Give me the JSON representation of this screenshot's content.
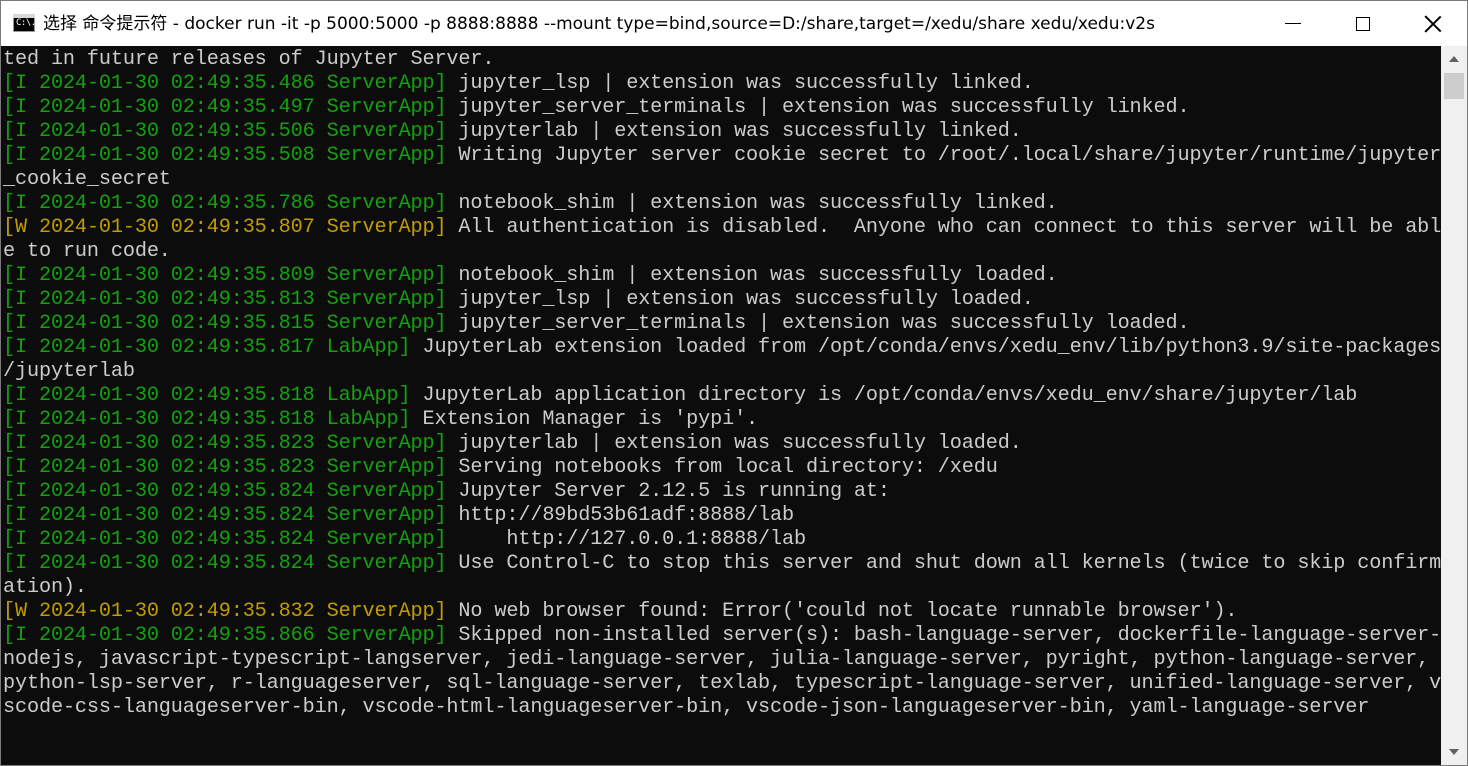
{
  "window": {
    "title": "选择 命令提示符 - docker  run -it -p 5000:5000 -p 8888:8888 --mount type=bind,source=D:/share,target=/xedu/share xedu/xedu:v2s",
    "icon_label": "C:\\."
  },
  "controls": {
    "minimize_icon": "minimize-icon",
    "maximize_icon": "maximize-icon",
    "close_icon": "close-icon"
  },
  "colors": {
    "background": "#0c0c0c",
    "text": "#cccccc",
    "info_prefix": "#13a10e",
    "warning_prefix": "#c19c00"
  },
  "console": {
    "lines": [
      {
        "prefix": "",
        "level": "",
        "text": "ted in future releases of Jupyter Server."
      },
      {
        "prefix": "[I 2024-01-30 02:49:35.486 ServerApp]",
        "level": "I",
        "text": " jupyter_lsp | extension was successfully linked."
      },
      {
        "prefix": "[I 2024-01-30 02:49:35.497 ServerApp]",
        "level": "I",
        "text": " jupyter_server_terminals | extension was successfully linked."
      },
      {
        "prefix": "[I 2024-01-30 02:49:35.506 ServerApp]",
        "level": "I",
        "text": " jupyterlab | extension was successfully linked."
      },
      {
        "prefix": "[I 2024-01-30 02:49:35.508 ServerApp]",
        "level": "I",
        "text": " Writing Jupyter server cookie secret to /root/.local/share/jupyter/runtime/jupyter"
      },
      {
        "prefix": "",
        "level": "",
        "text": "_cookie_secret"
      },
      {
        "prefix": "[I 2024-01-30 02:49:35.786 ServerApp]",
        "level": "I",
        "text": " notebook_shim | extension was successfully linked."
      },
      {
        "prefix": "[W 2024-01-30 02:49:35.807 ServerApp]",
        "level": "W",
        "text": " All authentication is disabled.  Anyone who can connect to this server will be abl"
      },
      {
        "prefix": "",
        "level": "",
        "text": "e to run code."
      },
      {
        "prefix": "[I 2024-01-30 02:49:35.809 ServerApp]",
        "level": "I",
        "text": " notebook_shim | extension was successfully loaded."
      },
      {
        "prefix": "[I 2024-01-30 02:49:35.813 ServerApp]",
        "level": "I",
        "text": " jupyter_lsp | extension was successfully loaded."
      },
      {
        "prefix": "[I 2024-01-30 02:49:35.815 ServerApp]",
        "level": "I",
        "text": " jupyter_server_terminals | extension was successfully loaded."
      },
      {
        "prefix": "[I 2024-01-30 02:49:35.817 LabApp]",
        "level": "I",
        "text": " JupyterLab extension loaded from /opt/conda/envs/xedu_env/lib/python3.9/site-packages"
      },
      {
        "prefix": "",
        "level": "",
        "text": "/jupyterlab"
      },
      {
        "prefix": "[I 2024-01-30 02:49:35.818 LabApp]",
        "level": "I",
        "text": " JupyterLab application directory is /opt/conda/envs/xedu_env/share/jupyter/lab"
      },
      {
        "prefix": "[I 2024-01-30 02:49:35.818 LabApp]",
        "level": "I",
        "text": " Extension Manager is 'pypi'."
      },
      {
        "prefix": "[I 2024-01-30 02:49:35.823 ServerApp]",
        "level": "I",
        "text": " jupyterlab | extension was successfully loaded."
      },
      {
        "prefix": "[I 2024-01-30 02:49:35.823 ServerApp]",
        "level": "I",
        "text": " Serving notebooks from local directory: /xedu"
      },
      {
        "prefix": "[I 2024-01-30 02:49:35.824 ServerApp]",
        "level": "I",
        "text": " Jupyter Server 2.12.5 is running at:"
      },
      {
        "prefix": "[I 2024-01-30 02:49:35.824 ServerApp]",
        "level": "I",
        "text": " http://89bd53b61adf:8888/lab"
      },
      {
        "prefix": "[I 2024-01-30 02:49:35.824 ServerApp]",
        "level": "I",
        "text": "     http://127.0.0.1:8888/lab"
      },
      {
        "prefix": "[I 2024-01-30 02:49:35.824 ServerApp]",
        "level": "I",
        "text": " Use Control-C to stop this server and shut down all kernels (twice to skip confirm"
      },
      {
        "prefix": "",
        "level": "",
        "text": "ation)."
      },
      {
        "prefix": "[W 2024-01-30 02:49:35.832 ServerApp]",
        "level": "W",
        "text": " No web browser found: Error('could not locate runnable browser')."
      },
      {
        "prefix": "[I 2024-01-30 02:49:35.866 ServerApp]",
        "level": "I",
        "text": " Skipped non-installed server(s): bash-language-server, dockerfile-language-server-"
      },
      {
        "prefix": "",
        "level": "",
        "text": "nodejs, javascript-typescript-langserver, jedi-language-server, julia-language-server, pyright, python-language-server,"
      },
      {
        "prefix": "",
        "level": "",
        "text": "python-lsp-server, r-languageserver, sql-language-server, texlab, typescript-language-server, unified-language-server, v"
      },
      {
        "prefix": "",
        "level": "",
        "text": "scode-css-languageserver-bin, vscode-html-languageserver-bin, vscode-json-languageserver-bin, yaml-language-server"
      }
    ]
  }
}
